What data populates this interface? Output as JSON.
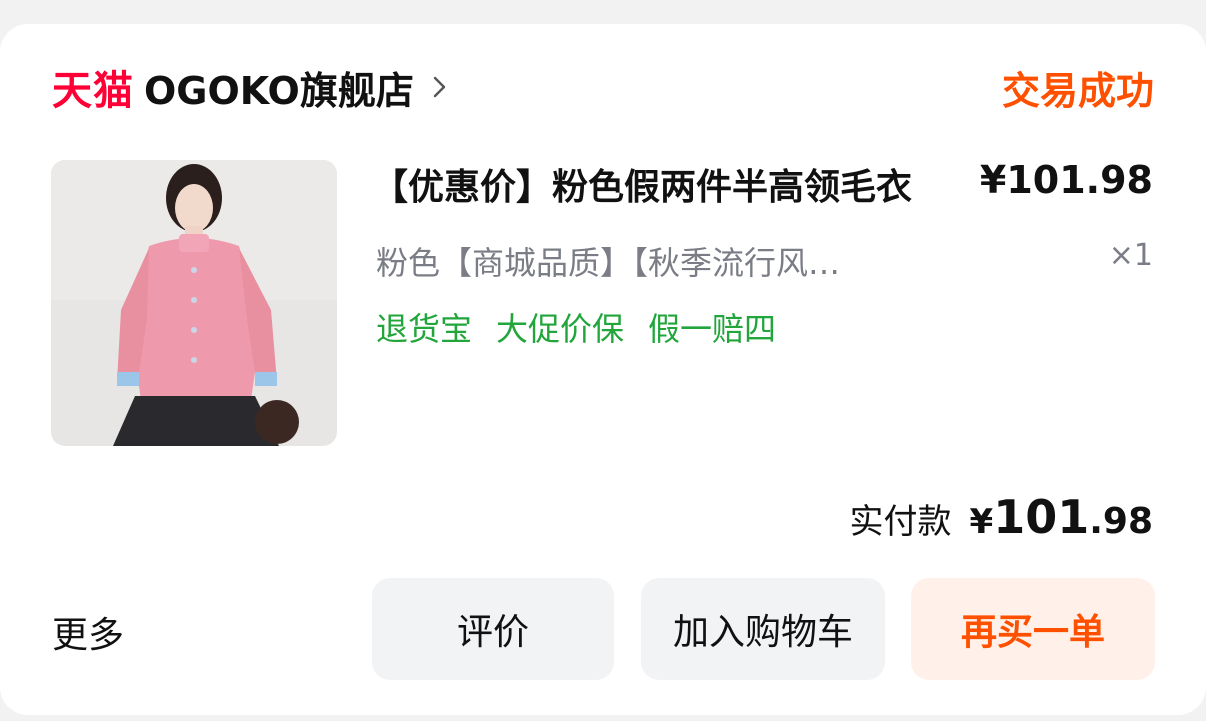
{
  "order": {
    "platform": "天猫",
    "shop_name": "OGOKO旗舰店",
    "status": "交易成功",
    "product": {
      "title": "【优惠价】粉色假两件半高领毛衣",
      "price": "¥101.98",
      "sku": "粉色【商城品质】【秋季流行风…",
      "quantity": "×1",
      "services": [
        "退货宝",
        "大促价保",
        "假一赔四"
      ]
    },
    "payment": {
      "label": "实付款",
      "currency": "¥",
      "amount_int": "101",
      "amount_dec": ".98"
    }
  },
  "actions": {
    "more": "更多",
    "review": "评价",
    "add_to_cart": "加入购物车",
    "buy_again": "再买一单"
  },
  "colors": {
    "platform_red": "#ff0036",
    "status_orange": "#ff5000",
    "service_green": "#22a63c",
    "secondary_gray": "#7a7d85"
  }
}
